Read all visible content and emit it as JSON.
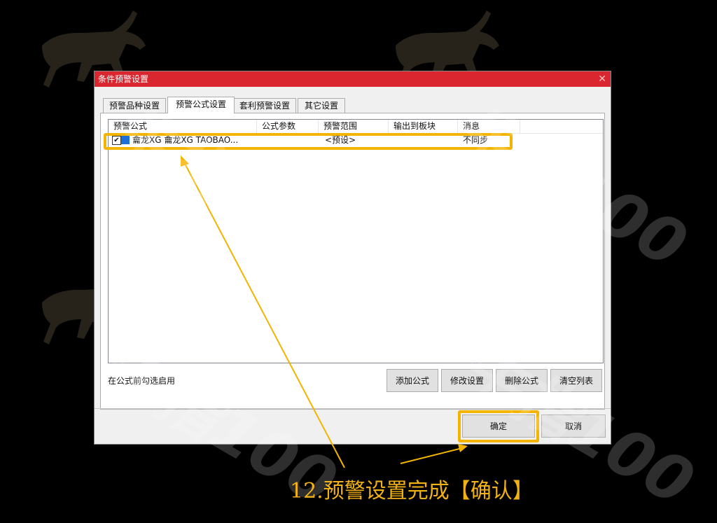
{
  "dialog": {
    "title": "条件预警设置",
    "close": "✕",
    "tabs": [
      "预警品种设置",
      "预警公式设置",
      "套利预警设置",
      "其它设置"
    ],
    "active_tab": 1,
    "columns": [
      "预警公式",
      "公式参数",
      "预警范围",
      "输出到板块",
      "消息"
    ],
    "rows": [
      {
        "checked": true,
        "checkmark": "✔",
        "formula": "龠龙XG 龠龙XG TAOBAO...",
        "params": "",
        "range": "<预设>",
        "output_block": "",
        "message": "不同步"
      }
    ],
    "hint": "在公式前勾选启用",
    "buttons": {
      "add": "添加公式",
      "modify": "修改设置",
      "delete": "删除公式",
      "clear": "清空列表",
      "ok": "确定",
      "cancel": "取消"
    }
  },
  "watermark": {
    "text": "牛指100"
  },
  "caption": "12.预警设置完成【确认】",
  "colors": {
    "title_bar": "#d9262f",
    "highlight": "#f3b400",
    "caption": "#f2b216",
    "background": "#000000"
  }
}
